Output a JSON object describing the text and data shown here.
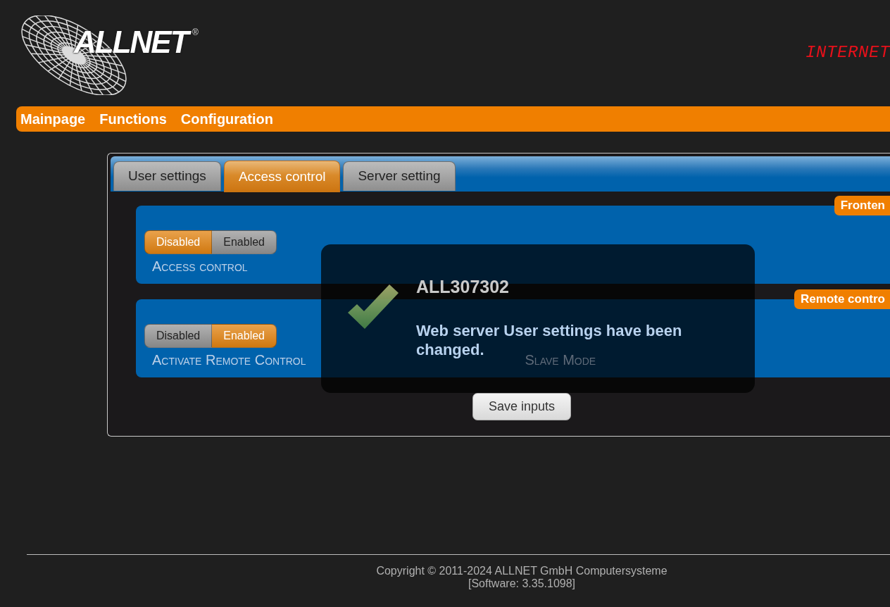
{
  "header": {
    "logo": {
      "text": "ALLNET",
      "registered_mark": "®"
    },
    "status_display": "INTERNET"
  },
  "nav": [
    {
      "label": "Mainpage"
    },
    {
      "label": "Functions"
    },
    {
      "label": "Configuration"
    }
  ],
  "tabs": [
    {
      "label": "User settings",
      "selected": false
    },
    {
      "label": "Access control",
      "selected": true
    },
    {
      "label": "Server setting",
      "selected": false
    }
  ],
  "sections": [
    {
      "badge": "Fronten",
      "settings": [
        {
          "label": "Access control",
          "dimmed": false,
          "options": [
            {
              "label": "Disabled",
              "selected": true
            },
            {
              "label": "Enabled",
              "selected": false
            }
          ]
        }
      ]
    },
    {
      "badge": "Remote contro",
      "settings": [
        {
          "label": "Activate Remote Control",
          "dimmed": false,
          "options": [
            {
              "label": "Disabled",
              "selected": false
            },
            {
              "label": "Enabled",
              "selected": true
            }
          ]
        },
        {
          "label": "Slave Mode",
          "dimmed": true
        }
      ]
    }
  ],
  "save_button": "Save inputs",
  "dialog": {
    "title": "ALL307302",
    "message": "Web server User settings have been changed."
  },
  "footer": {
    "copyright": "Copyright © 2011-2024 ALLNET GmbH Computersysteme",
    "software": "[Software: 3.35.1098]"
  }
}
